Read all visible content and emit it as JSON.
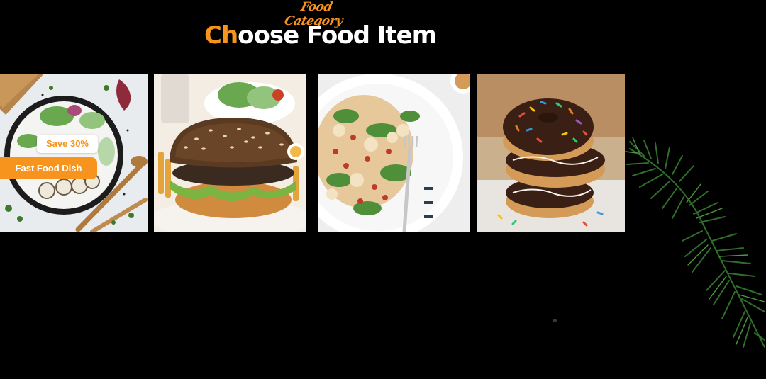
{
  "header": {
    "subtitle": "Food Category",
    "title_accent": "Ch",
    "title_rest": "oose Food Item"
  },
  "cards": [
    {
      "name": "fast-food-dish",
      "save_badge": "Save 30%",
      "label": "Fast Food Dish"
    },
    {
      "name": "burger"
    },
    {
      "name": "salad"
    },
    {
      "name": "donuts"
    }
  ],
  "colors": {
    "accent": "#f7941d",
    "background": "#000000",
    "title": "#ffffff"
  },
  "decorations": {
    "icons": [
      "dill-sprig-icon"
    ]
  }
}
